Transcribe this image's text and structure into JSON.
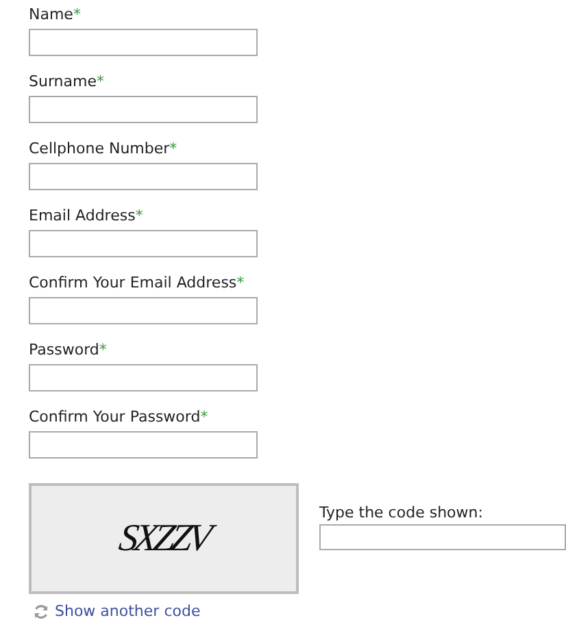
{
  "fields": [
    {
      "label": "Name",
      "required_mark": "*"
    },
    {
      "label": "Surname",
      "required_mark": "*"
    },
    {
      "label": "Cellphone Number",
      "required_mark": "*"
    },
    {
      "label": "Email Address",
      "required_mark": "*"
    },
    {
      "label": "Confirm Your Email Address",
      "required_mark": "*"
    },
    {
      "label": "Password",
      "required_mark": "*"
    },
    {
      "label": "Confirm Your Password",
      "required_mark": "*"
    }
  ],
  "captcha": {
    "code": "SXZZV",
    "prompt": "Type the code shown:",
    "refresh_link": "Show another code"
  }
}
